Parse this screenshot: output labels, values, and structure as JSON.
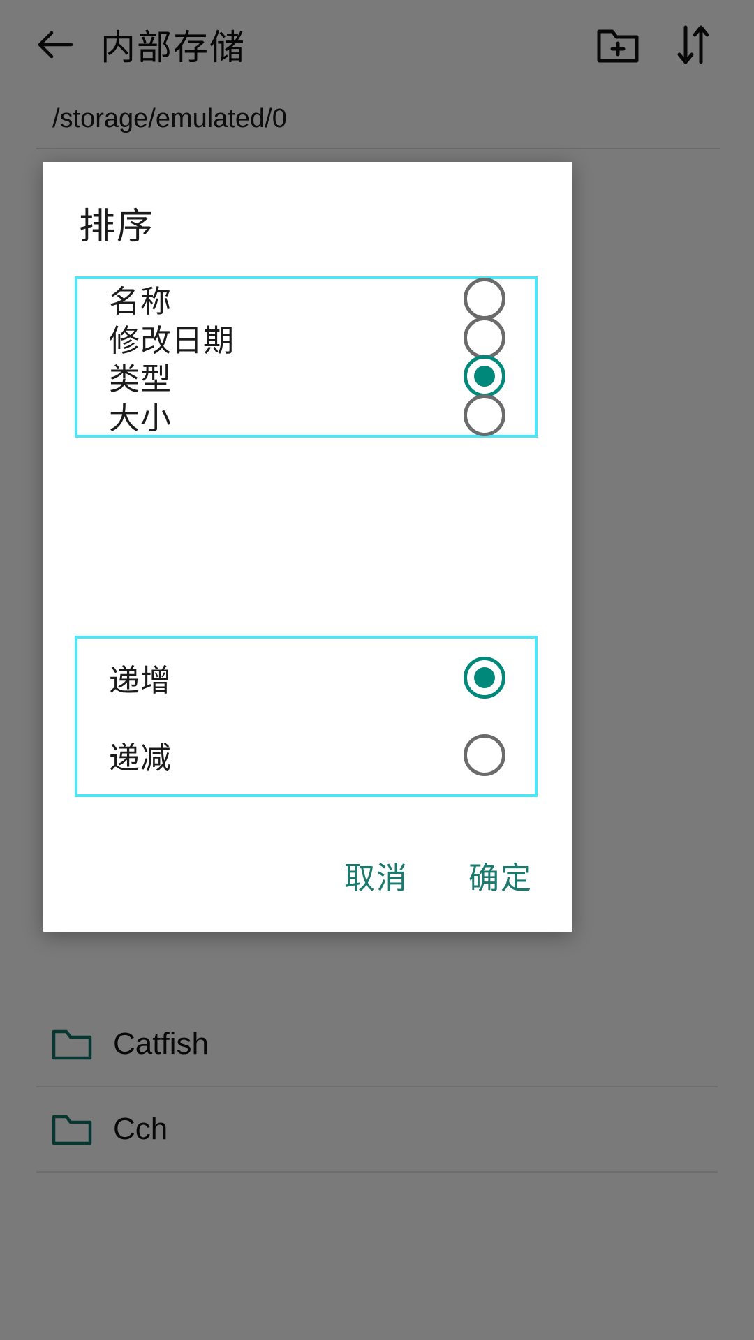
{
  "app": {
    "title": "内部存储",
    "path": "/storage/emulated/0",
    "back_icon": "arrow-left-icon",
    "new_folder_icon": "new-folder-icon",
    "sort_icon": "sort-arrows-icon",
    "files": [
      {
        "name": "Catfish",
        "icon": "folder-icon"
      },
      {
        "name": "Cch",
        "icon": "folder-icon"
      }
    ]
  },
  "dialog": {
    "title": "排序",
    "sort_by": {
      "options": [
        {
          "label": "名称",
          "selected": false
        },
        {
          "label": "修改日期",
          "selected": false
        },
        {
          "label": "类型",
          "selected": true
        },
        {
          "label": "大小",
          "selected": false
        }
      ]
    },
    "sort_direction": {
      "options": [
        {
          "label": "递增",
          "selected": true
        },
        {
          "label": "递减",
          "selected": false
        }
      ]
    },
    "cancel_label": "取消",
    "confirm_label": "确定"
  },
  "colors": {
    "accent_teal": "#00897b",
    "button_teal": "#1a7a6e",
    "highlight_cyan": "#4ee6f5",
    "radio_unselected": "#6b6b6b",
    "scrim": "rgba(0,0,0,0.52)"
  }
}
